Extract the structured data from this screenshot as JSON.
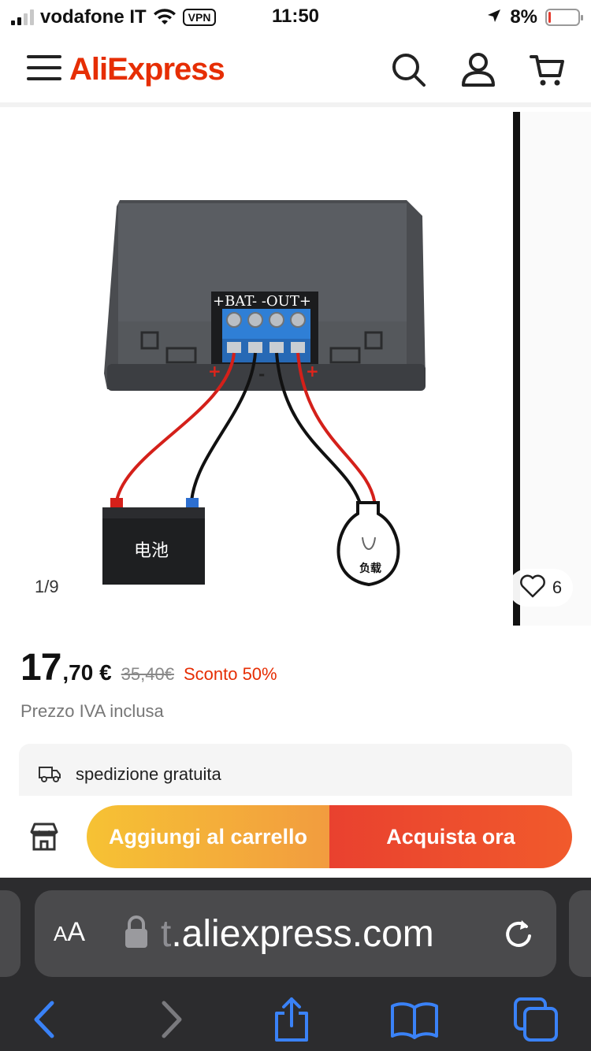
{
  "status_bar": {
    "carrier": "vodafone IT",
    "vpn_label": "VPN",
    "time": "11:50",
    "battery_percent": "8%",
    "battery_level": 0.08,
    "signal_bars_active": 2,
    "signal_bars_total": 4
  },
  "header": {
    "logo": "AliExpress",
    "menu_icon": "hamburger-menu-icon",
    "search_icon": "search-icon",
    "account_icon": "user-icon",
    "cart_icon": "cart-icon"
  },
  "gallery": {
    "counter": "1/9",
    "wishlist_count": "6",
    "image_labels": {
      "terminals": "+BAT-  -OUT+",
      "battery": "电池",
      "load": "负载",
      "plus": "+",
      "minus": "-"
    }
  },
  "product": {
    "price_int": "17",
    "price_dec": ",70 €",
    "price_old": "35,40€",
    "discount": "Sconto 50%",
    "vat_note": "Prezzo IVA inclusa",
    "shipping": "spedizione gratuita"
  },
  "actions": {
    "add_to_cart": "Aggiungi al carrello",
    "buy_now": "Acquista ora"
  },
  "browser": {
    "aa_label": "A",
    "aa_label_big": "A",
    "url_faded": "t",
    "url": ".aliexpress.com"
  },
  "colors": {
    "brand": "#e62e04",
    "cart_gradient_start": "#f6c234",
    "cart_gradient_end": "#f29c3f",
    "buy_gradient_start": "#e9412f",
    "buy_gradient_end": "#f15a2c",
    "browser_chrome": "#2c2c2e",
    "ios_blue": "#3a82f7"
  }
}
